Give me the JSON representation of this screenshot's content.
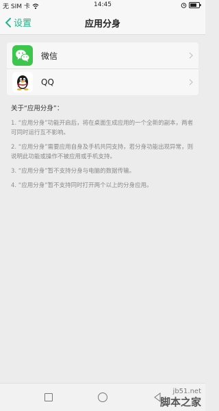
{
  "status_bar": {
    "carrier": "无 SIM 卡",
    "time": "14:45"
  },
  "nav": {
    "back_label": "设置",
    "title": "应用分身"
  },
  "apps": [
    {
      "name": "微信",
      "icon": "wechat-icon"
    },
    {
      "name": "QQ",
      "icon": "qq-icon"
    }
  ],
  "notes": {
    "title": "关于“应用分身”：",
    "items": [
      "1. “应用分身”功能开启后，将在桌面生成应用的一个全新的副本，两者可同时运行互不影响。",
      "2. “应用分身”需要应用自身及手机共同支持，若分身功能出现异常，则说明此功能或操作不被应用或手机支持。",
      "3. “应用分身”暂不支持分身与电脑的数据传输。",
      "4. “应用分身”暂不支持同时打开两个以上的分身应用。"
    ]
  },
  "watermark": {
    "site": "jb51.net",
    "name": "脚本之家"
  },
  "colors": {
    "accent": "#1fb489",
    "wechat": "#3cc64b",
    "background": "#ececec"
  }
}
